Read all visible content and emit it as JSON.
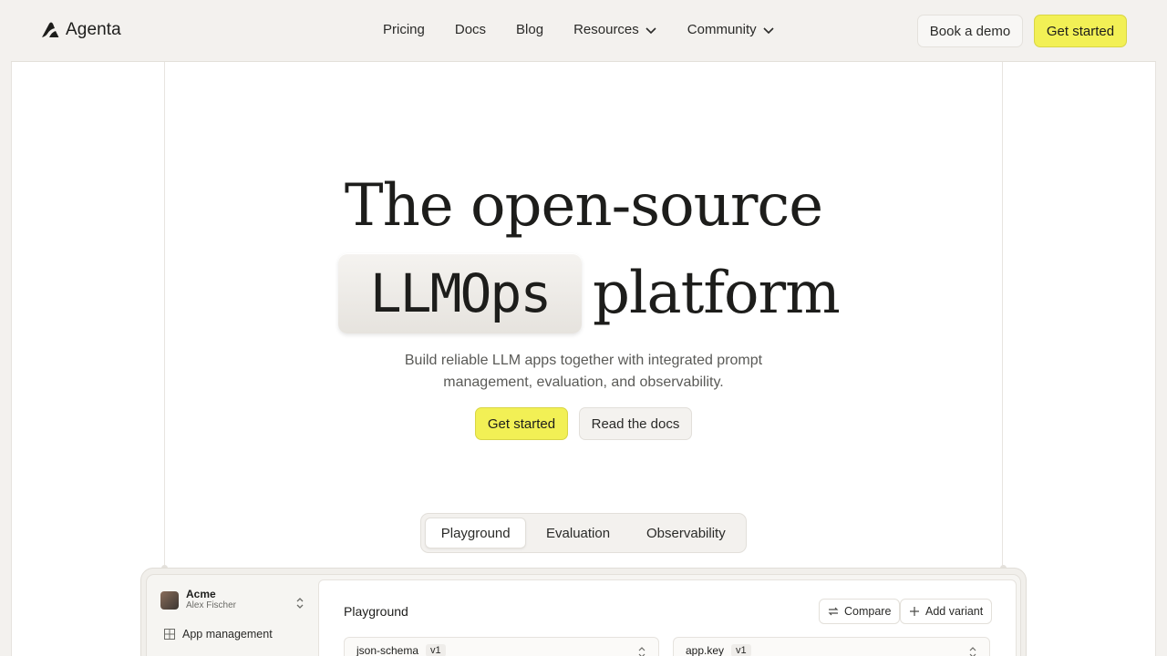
{
  "brand": {
    "name": "Agenta"
  },
  "nav": {
    "items": [
      {
        "label": "Pricing",
        "dropdown": false
      },
      {
        "label": "Docs",
        "dropdown": false
      },
      {
        "label": "Blog",
        "dropdown": false
      },
      {
        "label": "Resources",
        "dropdown": true
      },
      {
        "label": "Community",
        "dropdown": true
      }
    ],
    "book_demo": "Book a demo",
    "get_started": "Get started"
  },
  "hero": {
    "line1": "The open-source",
    "chip": "LLMOps",
    "line2_rest": "platform",
    "subtitle_line1": "Build reliable LLM apps together with integrated prompt",
    "subtitle_line2": "management, evaluation, and observability.",
    "primary_cta": "Get started",
    "secondary_cta": "Read the docs"
  },
  "tabs": [
    {
      "label": "Playground",
      "active": true
    },
    {
      "label": "Evaluation",
      "active": false
    },
    {
      "label": "Observability",
      "active": false
    }
  ],
  "preview": {
    "org_name": "Acme",
    "user_name": "Alex Fischer",
    "sidebar_item": "App management",
    "title": "Playground",
    "compare": "Compare",
    "add_variant": "Add variant",
    "fields": [
      {
        "name": "json-schema",
        "version": "v1"
      },
      {
        "name": "app.key",
        "version": "v1"
      }
    ]
  },
  "colors": {
    "accent_yellow": "#f2f055",
    "background": "#f3f1ee",
    "text": "#1d1d1b"
  }
}
